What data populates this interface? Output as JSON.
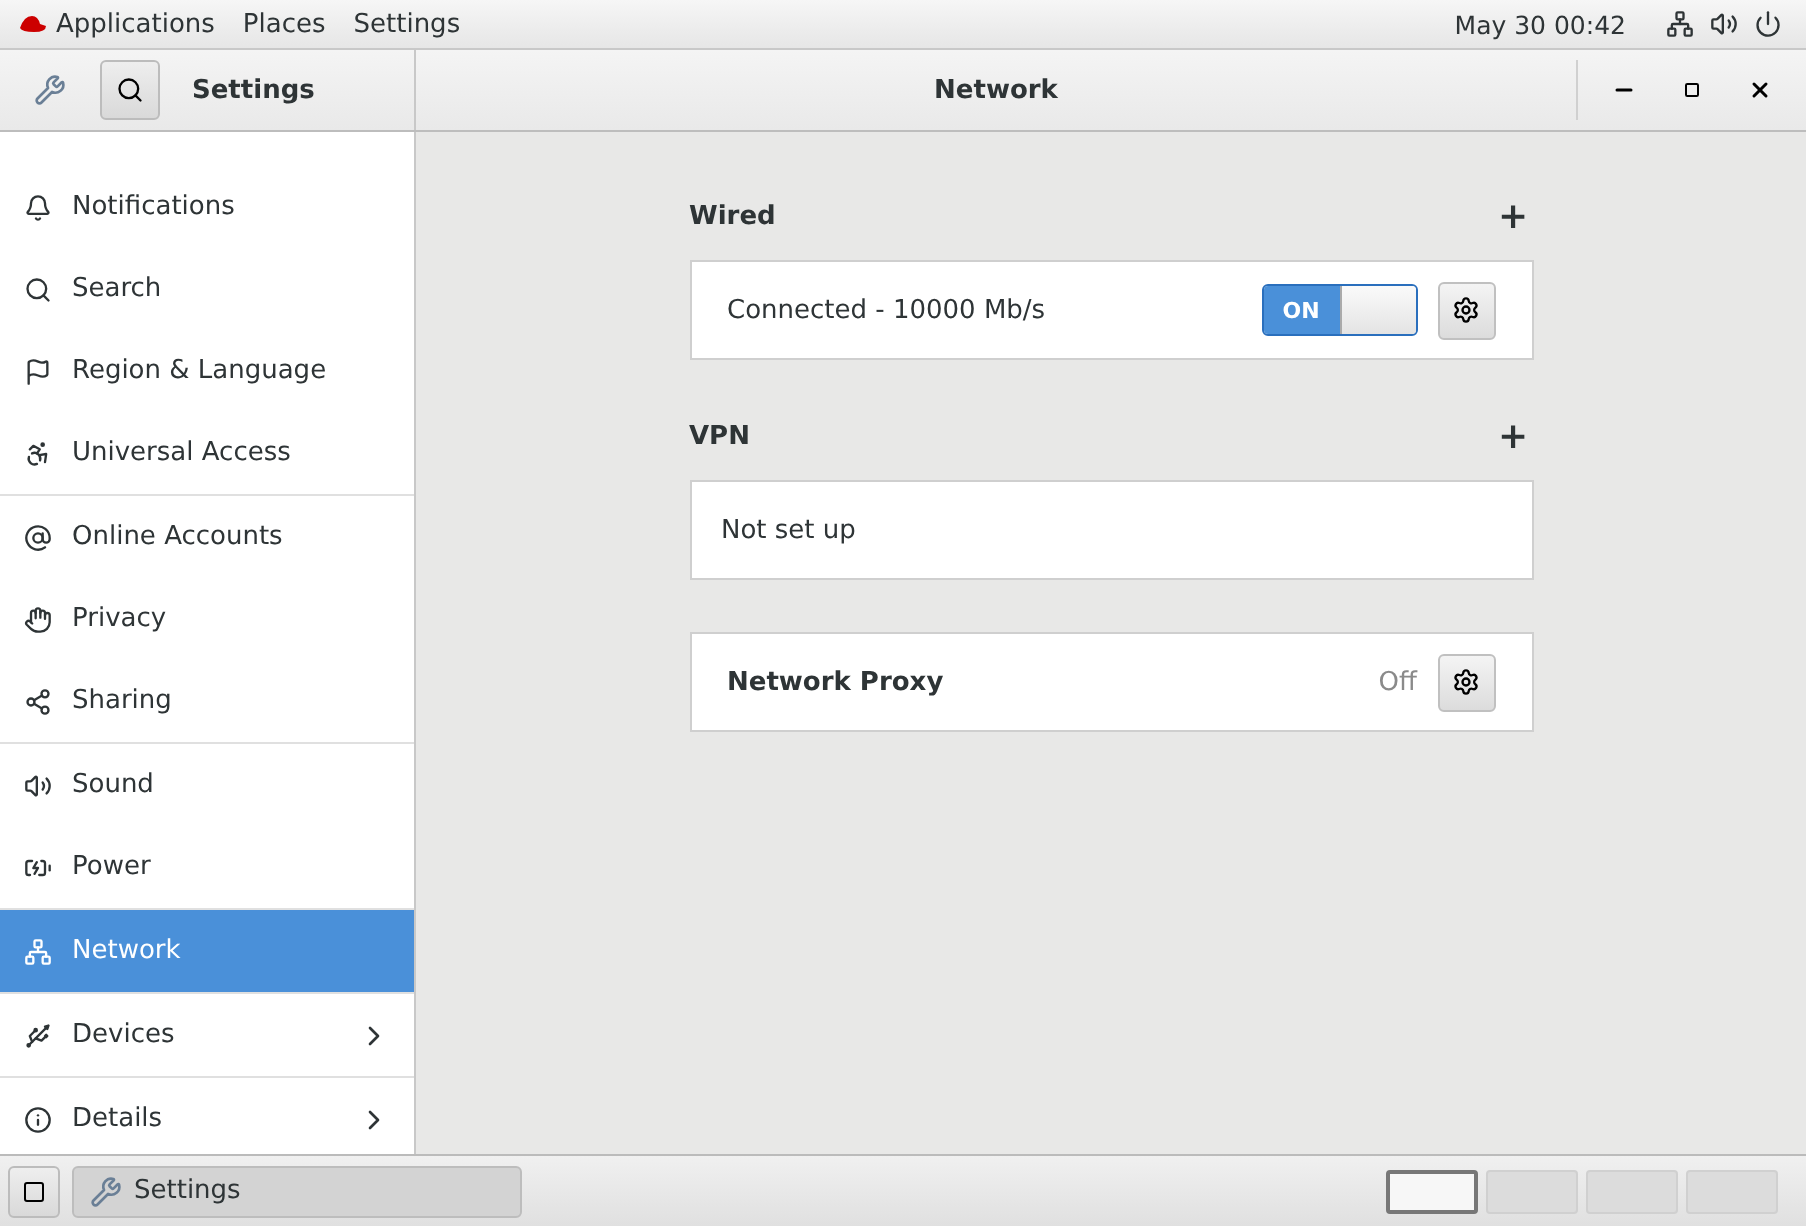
{
  "top_bar": {
    "menus": [
      "Applications",
      "Places",
      "Settings"
    ],
    "clock": "May 30 00:42"
  },
  "header": {
    "sidebar_title": "Settings",
    "title": "Network"
  },
  "sidebar": {
    "groups": [
      [
        {
          "label": "Notifications",
          "selected": false,
          "arrow": false
        },
        {
          "label": "Search",
          "selected": false,
          "arrow": false
        },
        {
          "label": "Region & Language",
          "selected": false,
          "arrow": false
        },
        {
          "label": "Universal Access",
          "selected": false,
          "arrow": false
        }
      ],
      [
        {
          "label": "Online Accounts",
          "selected": false,
          "arrow": false
        },
        {
          "label": "Privacy",
          "selected": false,
          "arrow": false
        },
        {
          "label": "Sharing",
          "selected": false,
          "arrow": false
        }
      ],
      [
        {
          "label": "Sound",
          "selected": false,
          "arrow": false
        },
        {
          "label": "Power",
          "selected": false,
          "arrow": false
        }
      ],
      [
        {
          "label": "Network",
          "selected": true,
          "arrow": false
        }
      ],
      [
        {
          "label": "Devices",
          "selected": false,
          "arrow": true
        }
      ],
      [
        {
          "label": "Details",
          "selected": false,
          "arrow": true
        }
      ]
    ]
  },
  "sections": [
    {
      "heading": "Wired",
      "add": "+",
      "rows": [
        {
          "kind": "connection",
          "label": "Connected - 10000 Mb/s",
          "switch": {
            "label": "ON",
            "on": true
          }
        }
      ]
    },
    {
      "heading": "VPN",
      "add": "+",
      "rows": [
        {
          "kind": "empty",
          "label": "Not set up"
        }
      ]
    },
    {
      "rows": [
        {
          "kind": "proxy",
          "label": "Network Proxy",
          "status": "Off"
        }
      ]
    }
  ],
  "taskbar": {
    "window": "Settings",
    "workspaces": [
      {
        "selected": true
      },
      {
        "selected": false
      },
      {
        "selected": false
      },
      {
        "selected": false
      }
    ]
  }
}
